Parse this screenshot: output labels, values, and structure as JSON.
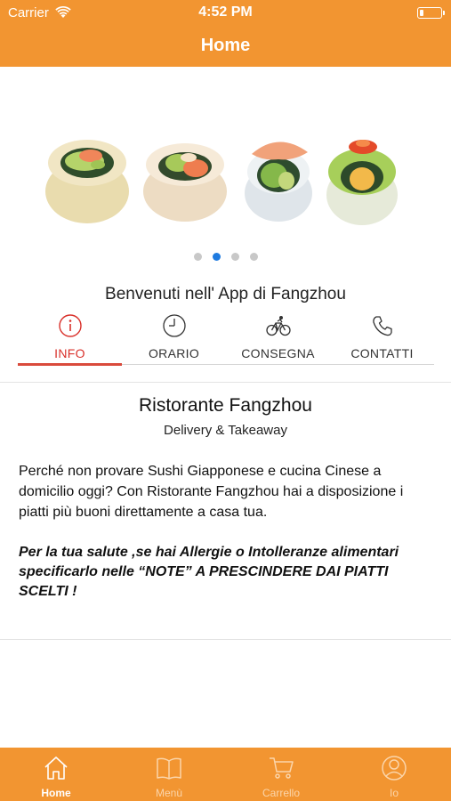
{
  "status_bar": {
    "carrier": "Carrier",
    "time": "4:52 PM",
    "battery_level": 0.2
  },
  "nav": {
    "title": "Home"
  },
  "carousel": {
    "page_count": 4,
    "active_page": 1
  },
  "welcome": "Benvenuti nell' App di Fangzhou",
  "tabs": [
    {
      "label": "INFO",
      "icon": "info-icon",
      "active": true
    },
    {
      "label": "ORARIO",
      "icon": "clock-icon",
      "active": false
    },
    {
      "label": "CONSEGNA",
      "icon": "bicycle-icon",
      "active": false
    },
    {
      "label": "CONTATTI",
      "icon": "phone-icon",
      "active": false
    }
  ],
  "info": {
    "name": "Ristorante Fangzhou",
    "subtitle": "Delivery & Takeaway",
    "description": "Perché non provare Sushi Giapponese e cucina Cinese a domicilio oggi? Con Ristorante Fangzhou hai a disposizione i piatti più buoni direttamente a casa tua.",
    "warning": "Per la tua salute ,se hai Allergie o Intolleranze alimentari specificarlo nelle “NOTE” A PRESCINDERE DAI PIATTI SCELTI !"
  },
  "tabbar": [
    {
      "label": "Home",
      "icon": "home-icon",
      "active": true
    },
    {
      "label": "Menù",
      "icon": "book-icon",
      "active": false
    },
    {
      "label": "Carrello",
      "icon": "cart-icon",
      "active": false
    },
    {
      "label": "Io",
      "icon": "user-icon",
      "active": false
    }
  ],
  "colors": {
    "brand_orange": "#f29531",
    "active_tab_red": "#d9312b",
    "active_dot_blue": "#1f7be0"
  }
}
